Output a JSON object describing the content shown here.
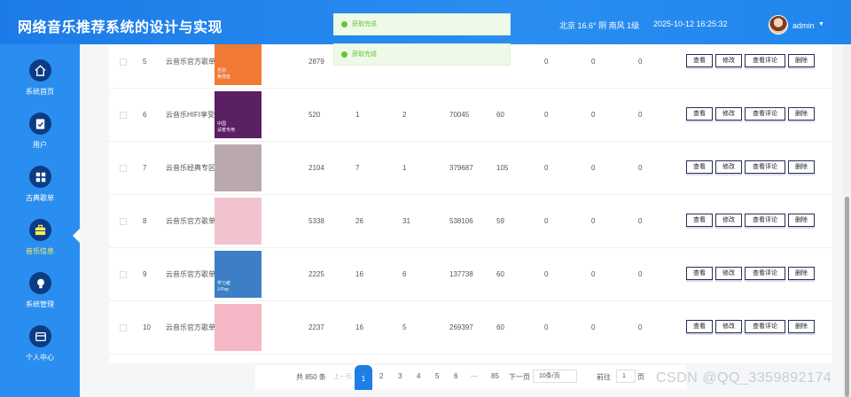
{
  "header": {
    "title": "网络音乐推荐系统的设计与实现",
    "weather": "北京  16.6° 阴 南风  1级",
    "datetime": "2025-10-12 16:25:32",
    "user": "admin",
    "caret": "▼"
  },
  "sidebar": {
    "items": [
      {
        "label": "系统首页",
        "icon": "home-icon"
      },
      {
        "label": "用户",
        "icon": "clipboard-check-icon"
      },
      {
        "label": "古典歌单",
        "icon": "grid-icon"
      },
      {
        "label": "音乐信息",
        "icon": "briefcase-icon",
        "active": true
      },
      {
        "label": "系统管理",
        "icon": "bulb-icon"
      },
      {
        "label": "个人中心",
        "icon": "wallet-icon"
      }
    ]
  },
  "toasts": [
    "获取完成",
    "获取完成"
  ],
  "table": {
    "rows": [
      {
        "index": "5",
        "name": "云音乐官方歌单",
        "c1": "2879",
        "c2": "",
        "c3": "",
        "c4": "",
        "c5": "",
        "c6": "0",
        "c7": "0",
        "c8": "0",
        "cover_color": "#f07a34",
        "cover_text": "告别\n焦虑症"
      },
      {
        "index": "6",
        "name": "云音乐HIFI享受",
        "c1": "520",
        "c2": "1",
        "c3": "2",
        "c4": "70045",
        "c5": "60",
        "c6": "0",
        "c7": "0",
        "c8": "0",
        "cover_color": "#5b1f63",
        "cover_text": "中国\n试者专用"
      },
      {
        "index": "7",
        "name": "云音乐经典专区",
        "c1": "2104",
        "c2": "7",
        "c3": "1",
        "c4": "379687",
        "c5": "105",
        "c6": "0",
        "c7": "0",
        "c8": "0",
        "cover_color": "#b9a9ad",
        "cover_text": ""
      },
      {
        "index": "8",
        "name": "云音乐官方歌单",
        "c1": "5338",
        "c2": "26",
        "c3": "31",
        "c4": "538106",
        "c5": "59",
        "c6": "0",
        "c7": "0",
        "c8": "0",
        "cover_color": "#f2c3cf",
        "cover_text": ""
      },
      {
        "index": "9",
        "name": "云音乐官方歌单",
        "c1": "2225",
        "c2": "16",
        "c3": "6",
        "c4": "137738",
        "c5": "60",
        "c6": "0",
        "c7": "0",
        "c8": "0",
        "cover_color": "#3d7fc5",
        "cover_text": "学习者\nJ-Pop"
      },
      {
        "index": "10",
        "name": "云音乐官方歌单",
        "c1": "2237",
        "c2": "16",
        "c3": "5",
        "c4": "269397",
        "c5": "60",
        "c6": "0",
        "c7": "0",
        "c8": "0",
        "cover_color": "#f5b7c6",
        "cover_text": ""
      }
    ],
    "actions": {
      "view": "查看",
      "edit": "修改",
      "comments": "查看评论",
      "delete": "删除"
    }
  },
  "pagination": {
    "total": "共 850 条",
    "prev": "上一页",
    "pages": [
      "1",
      "2",
      "3",
      "4",
      "5",
      "6"
    ],
    "ellipsis": "···",
    "last": "85",
    "next": "下一页",
    "page_size": "10条/页",
    "goto_prefix": "前往",
    "goto_value": "1",
    "goto_suffix": "页"
  },
  "watermark": "CSDN @QQ_3359892174",
  "colors": {
    "header": "#1f86ee",
    "sidebar": "#2a8ef0",
    "active_label": "#ffee58",
    "toast_text": "#67c23a"
  }
}
